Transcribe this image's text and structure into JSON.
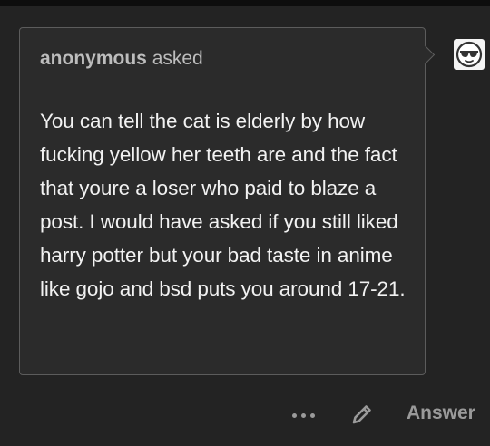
{
  "ask": {
    "asker_name": "anonymous",
    "asker_verb": "asked",
    "question": "You can tell the cat is elderly by how fucking yellow her teeth are and the fact that youre a loser who paid to blaze a post. I would have asked if you still liked harry potter but your bad taste in anime like gojo and bsd puts you around 17-21."
  },
  "avatar": {
    "icon": "anonymous-sunglasses-avatar-icon"
  },
  "actions": {
    "more_icon": "ellipsis-icon",
    "edit_icon": "pencil-icon",
    "answer_label": "Answer"
  },
  "colors": {
    "background": "#232323",
    "bubble": "#2b2b2b",
    "bubble_border": "#5c5c5c",
    "text": "#f2f2f2",
    "muted": "#9a9a9a"
  }
}
